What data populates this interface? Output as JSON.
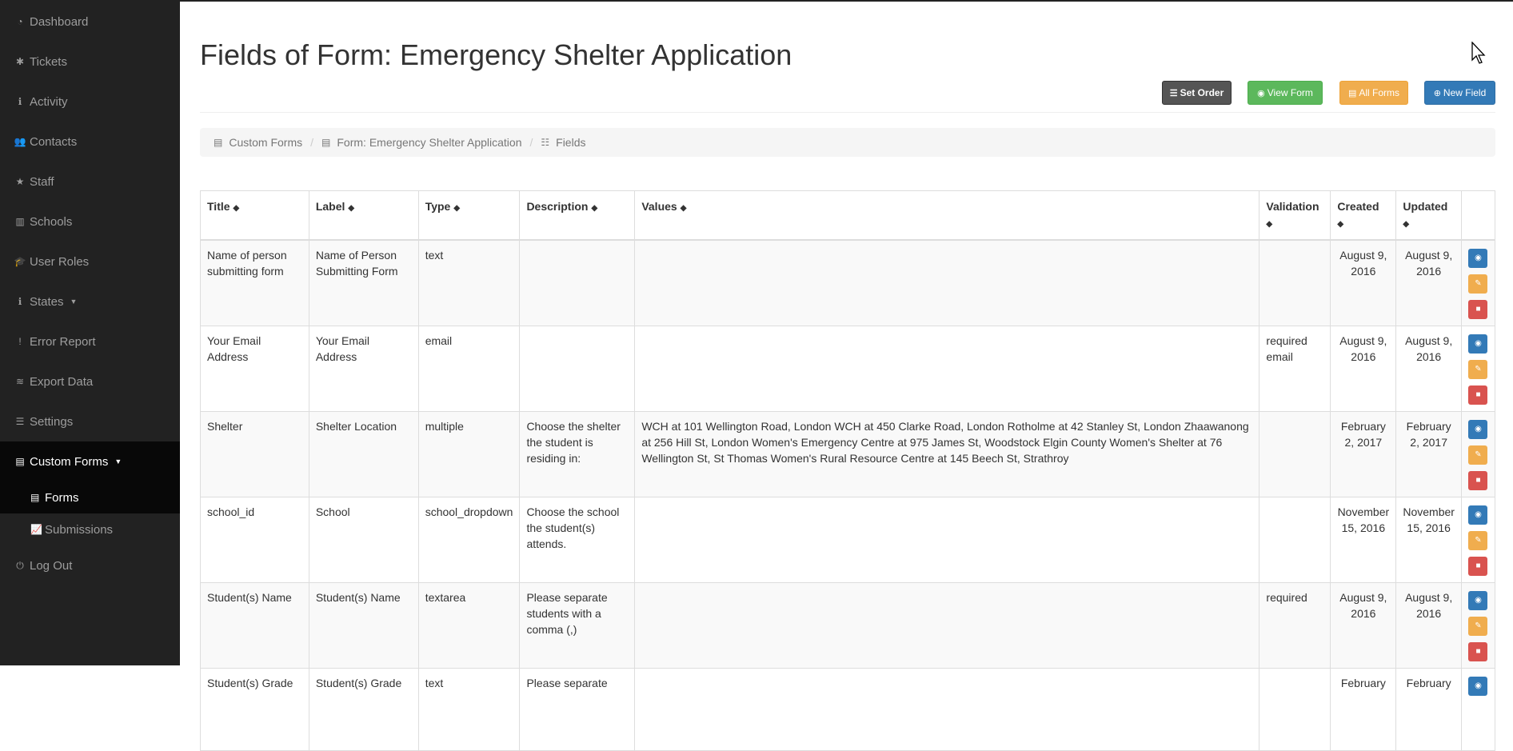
{
  "sidebar": {
    "items": [
      {
        "label": "Dashboard",
        "icon": "dashboard-icon",
        "glyph": "◔"
      },
      {
        "label": "Tickets",
        "icon": "asterisk-icon",
        "glyph": "✱"
      },
      {
        "label": "Activity",
        "icon": "info-icon",
        "glyph": "ℹ"
      },
      {
        "label": "Contacts",
        "icon": "users-icon",
        "glyph": "👥"
      },
      {
        "label": "Staff",
        "icon": "star-icon",
        "glyph": "★"
      },
      {
        "label": "Schools",
        "icon": "building-icon",
        "glyph": "▥"
      },
      {
        "label": "User Roles",
        "icon": "graduation-cap-icon",
        "glyph": "🎓"
      },
      {
        "label": "States",
        "icon": "info-icon",
        "glyph": "ℹ"
      },
      {
        "label": "Error Report",
        "icon": "exclamation-icon",
        "glyph": "!"
      },
      {
        "label": "Export Data",
        "icon": "database-icon",
        "glyph": "≋"
      },
      {
        "label": "Settings",
        "icon": "sliders-icon",
        "glyph": "☰"
      },
      {
        "label": "Custom Forms",
        "icon": "form-icon",
        "glyph": "▤"
      }
    ],
    "sub_items": [
      {
        "label": "Forms",
        "icon": "form-icon",
        "glyph": "▤"
      },
      {
        "label": "Submissions",
        "icon": "line-chart-icon",
        "glyph": "📈"
      }
    ],
    "logout": {
      "label": "Log Out",
      "icon": "power-icon",
      "glyph": "⏻"
    }
  },
  "header": {
    "title": "Fields of Form: Emergency Shelter Application"
  },
  "toolbar": {
    "set_order": "Set Order",
    "view_form": "View Form",
    "all_forms": "All Forms",
    "new_field": "New Field"
  },
  "breadcrumb": {
    "custom_forms": "Custom Forms",
    "form": "Form: Emergency Shelter Application",
    "fields": "Fields"
  },
  "table": {
    "columns": [
      "Title",
      "Label",
      "Type",
      "Description",
      "Values",
      "Validation",
      "Created",
      "Updated"
    ],
    "rows": [
      {
        "title": "Name of person submitting form",
        "label": "Name of Person Submitting Form",
        "type": "text",
        "description": "",
        "values": "",
        "validation": "",
        "created": "August 9, 2016",
        "updated": "August 9, 2016"
      },
      {
        "title": "Your Email Address",
        "label": "Your Email Address",
        "type": "email",
        "description": "",
        "values": "",
        "validation": "required email",
        "created": "August 9, 2016",
        "updated": "August 9, 2016"
      },
      {
        "title": "Shelter",
        "label": "Shelter Location",
        "type": "multiple",
        "description": "Choose the shelter the student is residing in:",
        "values": "WCH at 101 Wellington Road, London WCH at 450 Clarke Road, London Rotholme at 42 Stanley St, London Zhaawanong at 256 Hill St, London Women's Emergency Centre at 975 James St, Woodstock Elgin County Women's Shelter at 76 Wellington St, St Thomas Women's Rural Resource Centre at 145 Beech St, Strathroy",
        "validation": "",
        "created": "February 2, 2017",
        "updated": "February 2, 2017"
      },
      {
        "title": "school_id",
        "label": "School",
        "type": "school_dropdown",
        "description": "Choose the school the student(s) attends.",
        "values": "",
        "validation": "",
        "created": "November 15, 2016",
        "updated": "November 15, 2016"
      },
      {
        "title": "Student(s) Name",
        "label": "Student(s) Name",
        "type": "textarea",
        "description": "Please separate students with a comma (,)",
        "values": "",
        "validation": "required",
        "created": "August 9, 2016",
        "updated": "August 9, 2016"
      },
      {
        "title": "Student(s) Grade",
        "label": "Student(s) Grade",
        "type": "text",
        "description": "Please separate",
        "values": "",
        "validation": "",
        "created": "February",
        "updated": "February"
      }
    ]
  },
  "colors": {
    "sidebar_bg": "#222222",
    "sidebar_active_bg": "#080808",
    "primary": "#337ab7",
    "success": "#5cb85c",
    "warning": "#f0ad4e",
    "danger": "#d9534f"
  }
}
